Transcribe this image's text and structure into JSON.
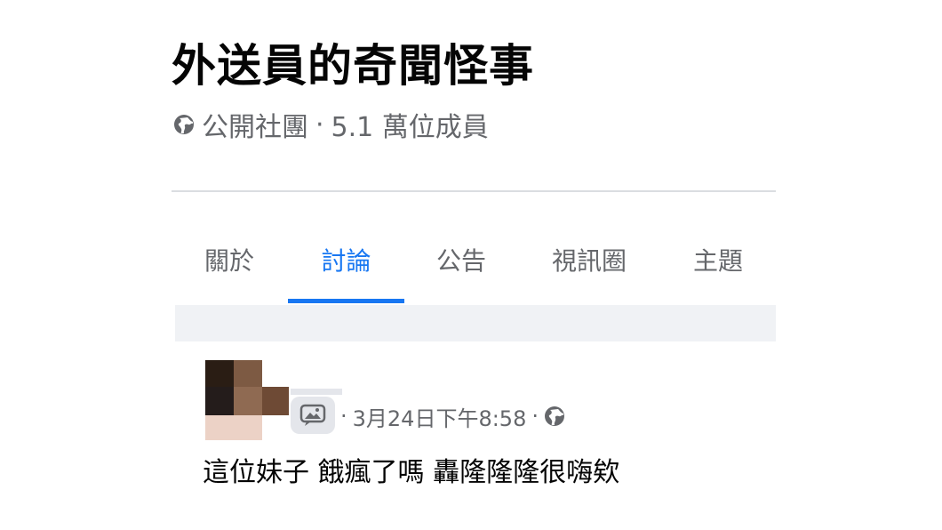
{
  "group": {
    "title": "外送員的奇聞怪事",
    "privacy_label": "公開社團",
    "member_count": "5.1 萬位成員",
    "privacy_icon": "globe-icon"
  },
  "tabs": [
    {
      "label": "關於",
      "active": false
    },
    {
      "label": "討論",
      "active": true
    },
    {
      "label": "公告",
      "active": false
    },
    {
      "label": "視訊圈",
      "active": false
    },
    {
      "label": "主題",
      "active": false
    }
  ],
  "post": {
    "timestamp": "3月24日下午8:58",
    "audience_icon": "globe-icon",
    "attachment_icon": "photo-comment-icon",
    "text": "這位妹子 餓瘋了嗎 轟隆隆隆很嗨欸"
  },
  "colors": {
    "accent": "#1877f2",
    "secondary_text": "#65676b",
    "primary_text": "#050505",
    "divider": "#dadde1",
    "feed_background": "#f0f2f5"
  }
}
